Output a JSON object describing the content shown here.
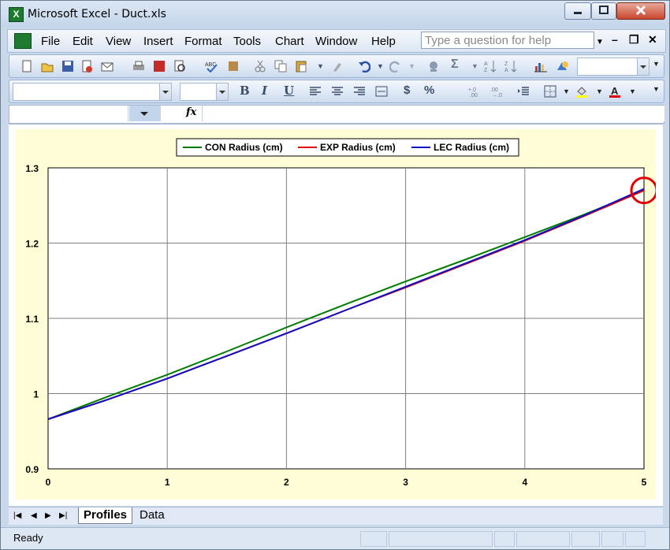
{
  "window": {
    "title": "Microsoft Excel - Duct.xls"
  },
  "menu": {
    "items": [
      "File",
      "Edit",
      "View",
      "Insert",
      "Format",
      "Tools",
      "Chart",
      "Window",
      "Help"
    ],
    "help_placeholder": "Type a question for help"
  },
  "formula_bar": {
    "fx_label": "fx"
  },
  "sheet_tabs": {
    "active": "Profiles",
    "other": "Data"
  },
  "status": {
    "text": "Ready"
  },
  "chart_data": {
    "type": "line",
    "title": "",
    "xlabel": "",
    "ylabel": "",
    "xlim": [
      0,
      5
    ],
    "ylim": [
      0.9,
      1.3
    ],
    "x_ticks": [
      "0",
      "1",
      "2",
      "3",
      "4",
      "5"
    ],
    "y_ticks": [
      "0.9",
      "1",
      "1.1",
      "1.2",
      "1.3"
    ],
    "grid": true,
    "legend_position": "top",
    "series": [
      {
        "name": "CON Radius (cm)",
        "color": "#007a00",
        "x": [
          0,
          0.5,
          1,
          1.5,
          2,
          2.5,
          3,
          3.5,
          4,
          4.5,
          5
        ],
        "y": [
          0.966,
          0.996,
          1.025,
          1.056,
          1.088,
          1.119,
          1.149,
          1.178,
          1.208,
          1.238,
          1.27
        ]
      },
      {
        "name": "EXP Radius (cm)",
        "color": "#e00000",
        "x": [
          0,
          0.5,
          1,
          1.5,
          2,
          2.5,
          3,
          3.5,
          4,
          4.5,
          5
        ],
        "y": [
          0.966,
          0.992,
          1.02,
          1.05,
          1.08,
          1.111,
          1.141,
          1.172,
          1.203,
          1.236,
          1.27
        ]
      },
      {
        "name": "LEC Radius (cm)",
        "color": "#1010c0",
        "x": [
          0,
          0.5,
          1,
          1.5,
          2,
          2.5,
          3,
          3.5,
          4,
          4.5,
          5
        ],
        "y": [
          0.966,
          0.992,
          1.02,
          1.05,
          1.08,
          1.111,
          1.142,
          1.173,
          1.204,
          1.237,
          1.272
        ]
      }
    ],
    "annotation": "red-circle-highlight"
  }
}
